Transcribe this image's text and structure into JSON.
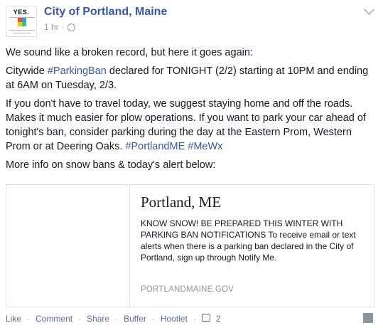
{
  "post": {
    "page_name": "City of Portland, Maine",
    "timestamp": "1 hr",
    "paragraphs": {
      "p1": "We sound like a broken record, but here it goes again:",
      "p2_pre": "Citywide ",
      "p2_tag": "#ParkingBan",
      "p2_post": " declared for TONIGHT (2/2) starting at 10PM and ending at 6AM on Tuesday, 2/3.",
      "p3_pre": "If you don't have to travel today, we suggest staying home and off the roads. Makes it much easier for plow operations. If you want to park your car ahead of tonight's ban, consider parking during the day at the Eastern Prom, Western Prom or at Deering Oaks. ",
      "p3_tag1": "#PortlandME",
      "p3_tag2": "#MeWx",
      "p4": "More info on snow bans & today's alert below:"
    }
  },
  "avatar": {
    "text": "YES."
  },
  "link_card": {
    "title": "Portland, ME",
    "description": "KNOW SNOW! BE PREPARED THIS WINTER WITH PARKING BAN NOTIFICATIONS To receive email or text alerts when there is a parking ban declared in the City of Portland, sign up through Notify Me.",
    "domain": "PORTLANDMAINE.GOV"
  },
  "actions": {
    "like": "Like",
    "comment": "Comment",
    "share": "Share",
    "buffer": "Buffer",
    "hootlet": "Hootlet",
    "like_count": "2"
  },
  "colors": {
    "link": "#3b5998",
    "meta": "#9197a3",
    "text": "#141823"
  },
  "icons": {
    "menu": "chevron-down-icon",
    "audience": "globe-icon"
  }
}
